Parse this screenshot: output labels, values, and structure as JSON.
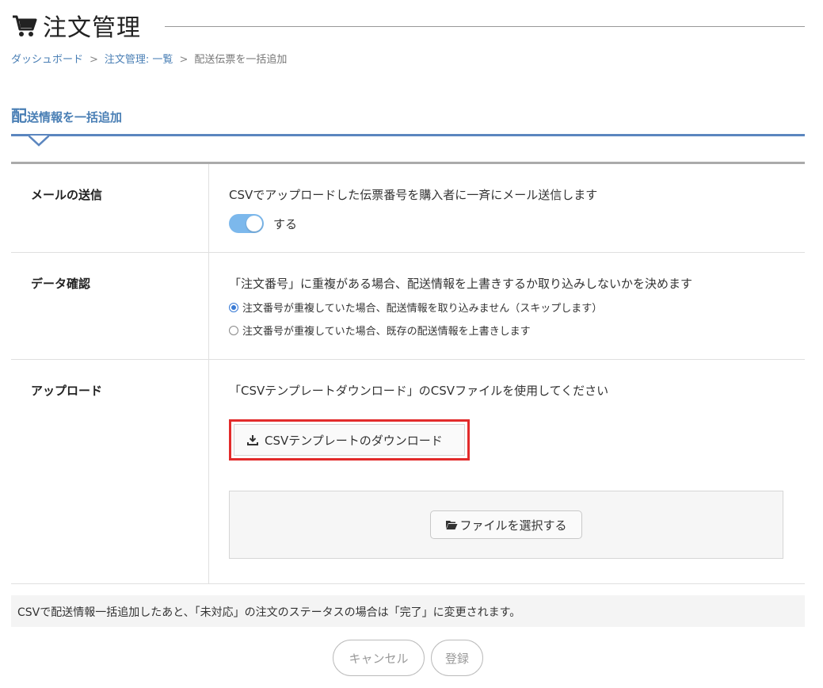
{
  "header": {
    "title": "注文管理",
    "icon": "cart-icon"
  },
  "breadcrumb": {
    "items": [
      "ダッシュボード",
      "注文管理: 一覧",
      "配送伝票を一括追加"
    ],
    "separator": ">"
  },
  "section": {
    "title_first": "配",
    "title_rest": "送情報を一括追加",
    "accent_color": "#4a7fb5"
  },
  "mail": {
    "label": "メールの送信",
    "description": "CSVでアップロードした伝票番号を購入者に一斉にメール送信します",
    "toggle_label": "する",
    "toggle_on": true
  },
  "data_check": {
    "label": "データ確認",
    "description": "「注文番号」に重複がある場合、配送情報を上書きするか取り込みしないかを決めます",
    "options": [
      {
        "label": "注文番号が重複していた場合、配送情報を取り込みません（スキップします）",
        "checked": true
      },
      {
        "label": "注文番号が重複していた場合、既存の配送情報を上書きします",
        "checked": false
      }
    ]
  },
  "upload": {
    "label": "アップロード",
    "description": "「CSVテンプレートダウンロード」のCSVファイルを使用してください",
    "download_button": "CSVテンプレートのダウンロード",
    "file_button": "ファイルを選択する",
    "highlight_color": "#e22b2b"
  },
  "note": "CSVで配送情報一括追加したあと、「未対応」の注文のステータスの場合は「完了」に変更されます。",
  "actions": {
    "cancel": "キャンセル",
    "submit": "登録"
  }
}
